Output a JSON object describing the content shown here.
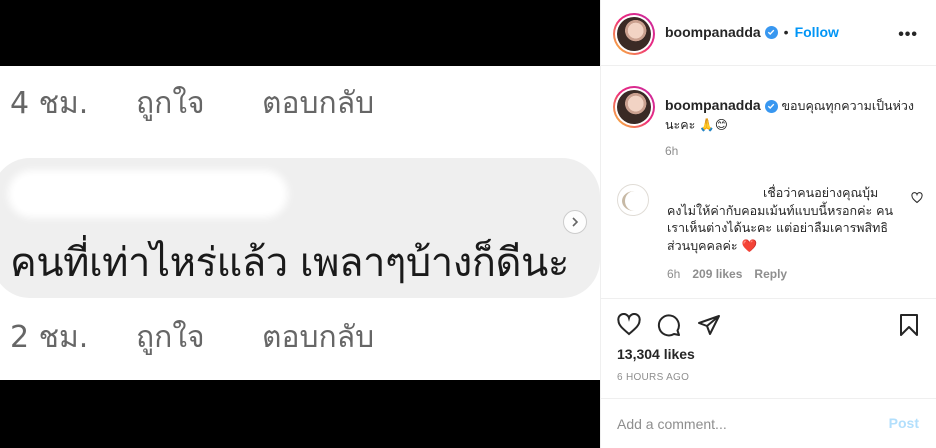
{
  "media": {
    "row_top": {
      "time": "4 ชม.",
      "like": "ถูกใจ",
      "reply": "ตอบกลับ"
    },
    "comment_text": "คนที่เท่าไหร่แล้ว เพลาๆบ้างก็ดีนะ",
    "row_bottom": {
      "time": "2 ชม.",
      "like": "ถูกใจ",
      "reply": "ตอบกลับ"
    },
    "next_icon": "chevron-right-icon"
  },
  "header": {
    "username": "boompanadda",
    "separator": "•",
    "follow_label": "Follow",
    "more_label": "•••"
  },
  "caption": {
    "username": "boompanadda",
    "text": "ขอบคุณทุกความเป็นห่วงนะคะ 🙏😊",
    "time": "6h"
  },
  "comment": {
    "line1": "เชื่อว่าคนอย่างคุณบุ้ม",
    "rest": "คงไม่ให้ค่ากับคอมเม้นท์แบบนี้หรอกค่ะ คนเราเห็นต่างได้นะคะ แต่อย่าลืมเคารพสิทธิส่วนบุคคลค่ะ ❤️",
    "time": "6h",
    "likes": "209 likes",
    "reply_label": "Reply"
  },
  "actions": {
    "likes": "13,304 likes",
    "time_ago": "6 HOURS AGO"
  },
  "add_comment": {
    "placeholder": "Add a comment...",
    "post_label": "Post"
  },
  "colors": {
    "link_blue": "#0095f6",
    "verified_blue": "#3897f0",
    "post_disabled": "#b2dffc",
    "muted": "#8e8e8e"
  }
}
